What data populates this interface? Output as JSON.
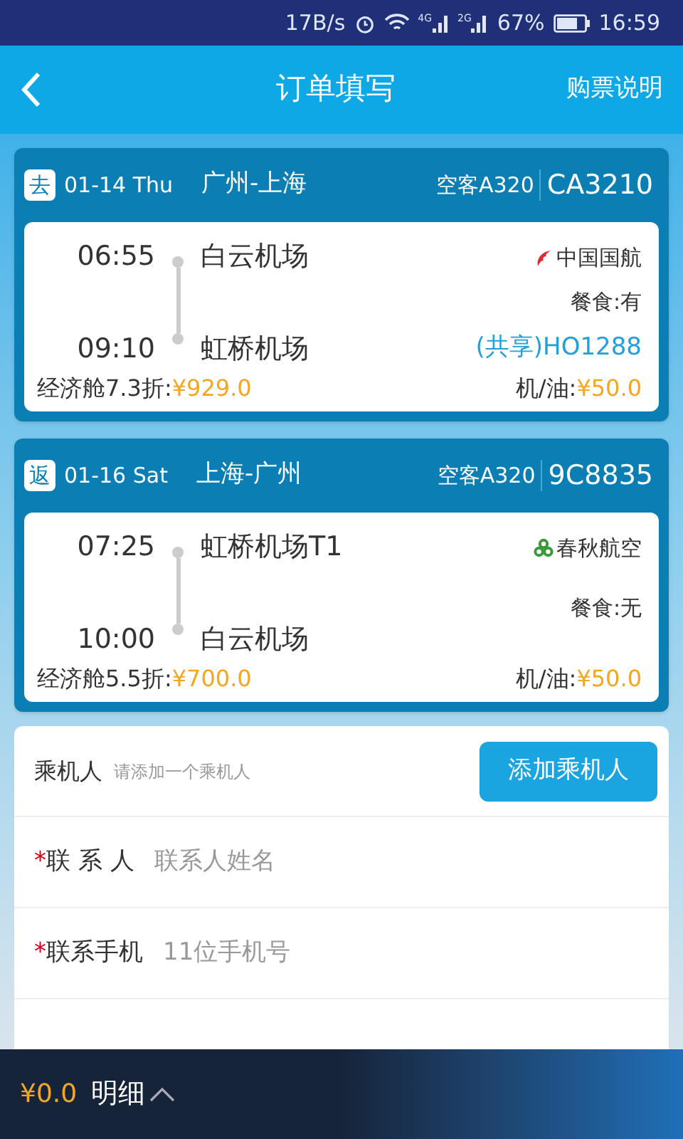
{
  "status_bar": {
    "speed": "17B/s",
    "signal_labels": [
      "4G",
      "2G"
    ],
    "battery_text": "67%",
    "time": "16:59"
  },
  "header": {
    "title": "订单填写",
    "action": "购票说明"
  },
  "flights": [
    {
      "tag": "去",
      "date": "01-14 Thu",
      "route": "广州-上海",
      "aircraft": "空客A320",
      "flight_no": "CA3210",
      "dep_time": "06:55",
      "dep_airport": "白云机场",
      "arr_time": "09:10",
      "arr_airport": "虹桥机场",
      "airline": "中国国航",
      "kind": "phoenix",
      "meal": "餐食:有",
      "codeshare": "(共享)HO1288",
      "cabin": "经济舱7.3折:",
      "price": "¥929.0",
      "tax_label": "机/油:",
      "tax": "¥50.0"
    },
    {
      "tag": "返",
      "date": "01-16 Sat",
      "route": "上海-广州",
      "aircraft": "空客A320",
      "flight_no": "9C8835",
      "dep_time": "07:25",
      "dep_airport": "虹桥机场T1",
      "arr_time": "10:00",
      "arr_airport": "白云机场",
      "airline": "春秋航空",
      "kind": "clover",
      "meal": "餐食:无",
      "cabin": "经济舱5.5折:",
      "price": "¥700.0",
      "tax_label": "机/油:",
      "tax": "¥50.0"
    }
  ],
  "passenger": {
    "label": "乘机人",
    "hint": "请添加一个乘机人",
    "button": "添加乘机人"
  },
  "fields": [
    {
      "required_mark": "*",
      "label": "联 系 人",
      "placeholder": "联系人姓名"
    },
    {
      "required_mark": "*",
      "label": "联系手机",
      "placeholder": "11位手机号"
    }
  ],
  "bottom_bar": {
    "total": "¥0.0",
    "details": "明细"
  }
}
